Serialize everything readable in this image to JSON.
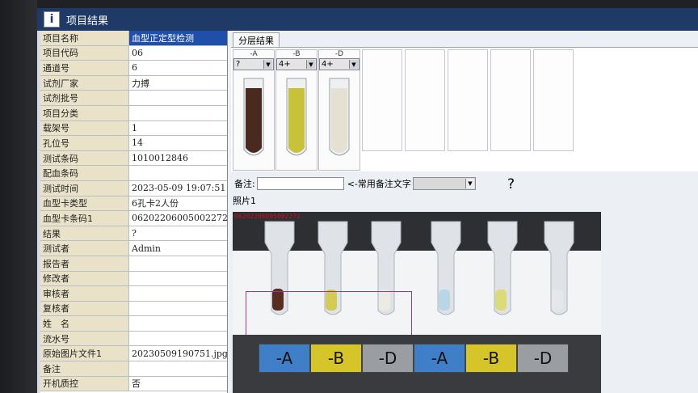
{
  "window": {
    "title": "项目结果",
    "icon": "info-icon"
  },
  "properties": [
    {
      "key": "项目名称",
      "value": "血型正定型检测",
      "selected": true
    },
    {
      "key": "项目代码",
      "value": "06"
    },
    {
      "key": "通道号",
      "value": "6"
    },
    {
      "key": "试剂厂家",
      "value": "力搏"
    },
    {
      "key": "试剂批号",
      "value": ""
    },
    {
      "key": "项目分类",
      "value": ""
    },
    {
      "key": "载架号",
      "value": "1"
    },
    {
      "key": "孔位号",
      "value": "14"
    },
    {
      "key": "测试条码",
      "value": "1010012846"
    },
    {
      "key": "配血条码",
      "value": ""
    },
    {
      "key": "测试时间",
      "value": "2023-05-09 19:07:51"
    },
    {
      "key": "血型卡类型",
      "value": "6孔卡2人份"
    },
    {
      "key": "血型卡条码1",
      "value": "062022060050022​72"
    },
    {
      "key": "结果",
      "value": "?"
    },
    {
      "key": "测试者",
      "value": "Admin"
    },
    {
      "key": "报告者",
      "value": ""
    },
    {
      "key": "修改者",
      "value": ""
    },
    {
      "key": "审核者",
      "value": ""
    },
    {
      "key": "复核者",
      "value": ""
    },
    {
      "key": "姓　名",
      "value": ""
    },
    {
      "key": "流水号",
      "value": ""
    },
    {
      "key": "原始图片文件1",
      "value": "20230509190751.jpg"
    },
    {
      "key": "备注",
      "value": ""
    },
    {
      "key": "开机质控",
      "value": "否"
    }
  ],
  "tab": {
    "label": "分层结果"
  },
  "tubes": [
    {
      "label": "-A",
      "value": "?",
      "color": "#4a2a1f"
    },
    {
      "label": "-B",
      "value": "4+",
      "color": "#c8c23a"
    },
    {
      "label": "-D",
      "value": "4+",
      "color": "#e5e1d2"
    }
  ],
  "notes": {
    "label": "备注:",
    "common_label": "<-常用备注文字",
    "help": "?"
  },
  "photo": {
    "label": "照片1",
    "code": "062022060050022​72"
  },
  "card_labels": [
    {
      "text": "-A",
      "color": "#3f7fc7"
    },
    {
      "text": "-B",
      "color": "#d6c52a"
    },
    {
      "text": "-D",
      "color": "#9a9ea3"
    },
    {
      "text": "-A",
      "color": "#3f7fc7"
    },
    {
      "text": "-B",
      "color": "#d6c52a"
    },
    {
      "text": "-D",
      "color": "#9a9ea3"
    }
  ]
}
